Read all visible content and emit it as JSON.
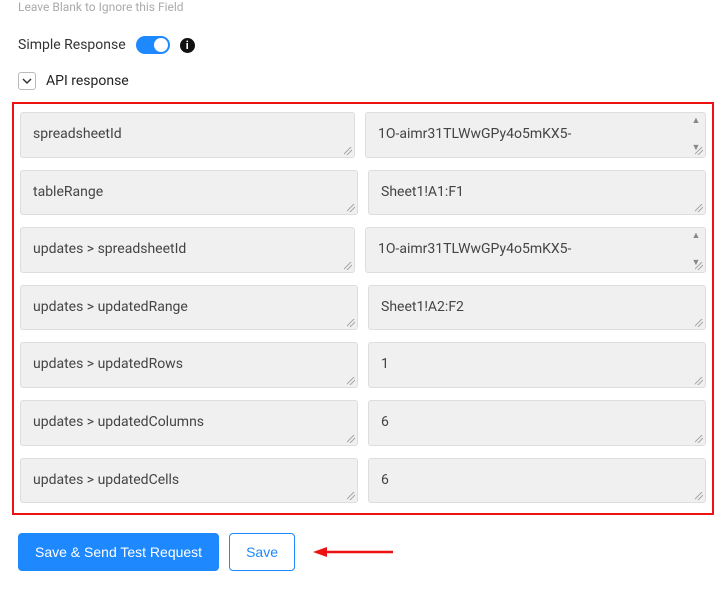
{
  "hint_text": "Leave Blank to Ignore this Field",
  "simple_response": {
    "label": "Simple Response",
    "on": true
  },
  "section": {
    "title": "API response",
    "rows": [
      {
        "key": "spreadsheetId",
        "val": "1O-aimr31TLWwGPy4o5mKX5-",
        "stepper": true
      },
      {
        "key": "tableRange",
        "val": "Sheet1!A1:F1",
        "stepper": false
      },
      {
        "key": "updates > spreadsheetId",
        "val": "1O-aimr31TLWwGPy4o5mKX5-",
        "stepper": true
      },
      {
        "key": "updates > updatedRange",
        "val": "Sheet1!A2:F2",
        "stepper": false
      },
      {
        "key": "updates > updatedRows",
        "val": "1",
        "stepper": false
      },
      {
        "key": "updates > updatedColumns",
        "val": "6",
        "stepper": false
      },
      {
        "key": "updates > updatedCells",
        "val": "6",
        "stepper": false
      }
    ]
  },
  "actions": {
    "save_send_label": "Save & Send Test Request",
    "save_label": "Save"
  }
}
